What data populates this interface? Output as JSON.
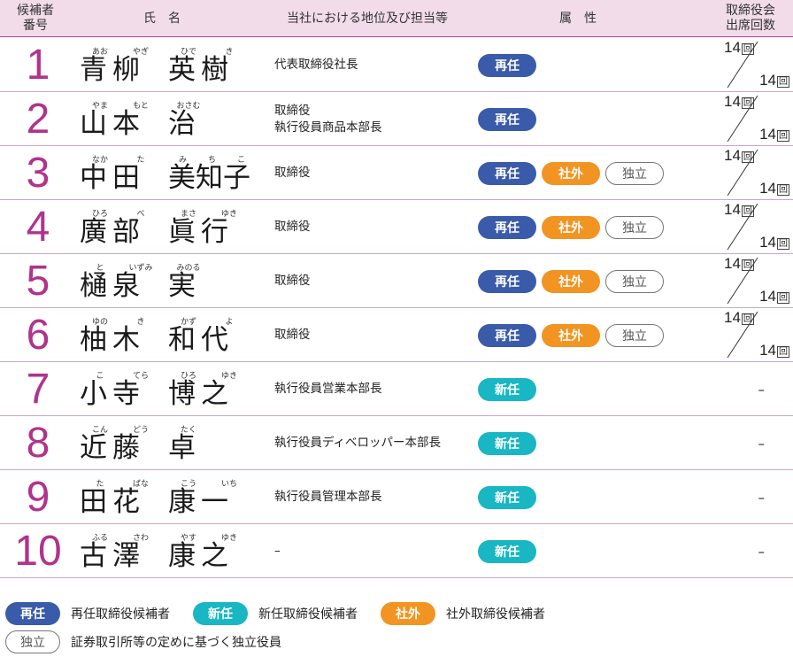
{
  "header": {
    "num_line1": "候補者",
    "num_line2": "番号",
    "name": "氏名",
    "position": "当社における地位及び担当等",
    "attributes": "属性",
    "attendance_line1": "取締役会",
    "attendance_line2": "出席回数"
  },
  "badges": {
    "reappoint": "再任",
    "new": "新任",
    "outside": "社外",
    "independent": "独立"
  },
  "attendance_unit": "回",
  "candidates": [
    {
      "num": "1",
      "surname": "青柳",
      "given": "英樹",
      "surname_ruby": [
        "あお",
        "やぎ"
      ],
      "given_ruby": [
        "ひで",
        "き"
      ],
      "position": [
        "代表取締役社長"
      ],
      "attendance_top": "14",
      "attendance_bottom": "14"
    },
    {
      "num": "2",
      "surname": "山本",
      "given": "治",
      "surname_ruby": [
        "やま",
        "もと"
      ],
      "given_ruby": [
        "おさむ"
      ],
      "position": [
        "取締役",
        "執行役員商品本部長"
      ],
      "attendance_top": "14",
      "attendance_bottom": "14"
    },
    {
      "num": "3",
      "surname": "中田",
      "given": "美知子",
      "surname_ruby": [
        "なか",
        "た"
      ],
      "given_ruby": [
        "み",
        "ち",
        "こ"
      ],
      "position": [
        "取締役"
      ],
      "attendance_top": "14",
      "attendance_bottom": "14"
    },
    {
      "num": "4",
      "surname": "廣部",
      "given": "眞行",
      "surname_ruby": [
        "ひろ",
        "べ"
      ],
      "given_ruby": [
        "まさ",
        "ゆき"
      ],
      "position": [
        "取締役"
      ],
      "attendance_top": "14",
      "attendance_bottom": "14"
    },
    {
      "num": "5",
      "surname": "樋泉",
      "given": "実",
      "surname_ruby": [
        "と",
        "いずみ"
      ],
      "given_ruby": [
        "みのる"
      ],
      "position": [
        "取締役"
      ],
      "attendance_top": "14",
      "attendance_bottom": "14"
    },
    {
      "num": "6",
      "surname": "柚木",
      "given": "和代",
      "surname_ruby": [
        "ゆの",
        "き"
      ],
      "given_ruby": [
        "かず",
        "よ"
      ],
      "position": [
        "取締役"
      ],
      "attendance_top": "14",
      "attendance_bottom": "14"
    },
    {
      "num": "7",
      "surname": "小寺",
      "given": "博之",
      "surname_ruby": [
        "こ",
        "てら"
      ],
      "given_ruby": [
        "ひろ",
        "ゆき"
      ],
      "position": [
        "執行役員営業本部長"
      ],
      "attendance_dash": "–"
    },
    {
      "num": "8",
      "surname": "近藤",
      "given": "卓",
      "surname_ruby": [
        "こん",
        "どう"
      ],
      "given_ruby": [
        "たく"
      ],
      "position": [
        "執行役員ディベロッパー本部長"
      ],
      "attendance_dash": "–"
    },
    {
      "num": "9",
      "surname": "田花",
      "given": "康一",
      "surname_ruby": [
        "た",
        "ばな"
      ],
      "given_ruby": [
        "こう",
        "いち"
      ],
      "position": [
        "執行役員管理本部長"
      ],
      "attendance_dash": "–"
    },
    {
      "num": "10",
      "surname": "古澤",
      "given": "康之",
      "surname_ruby": [
        "ふる",
        "さわ"
      ],
      "given_ruby": [
        "やす",
        "ゆき"
      ],
      "position": [
        "–"
      ],
      "attendance_dash": "–"
    }
  ],
  "legend": {
    "reappoint": "再任取締役候補者",
    "new": "新任取締役候補者",
    "outside": "社外取締役候補者",
    "independent": "証券取引所等の定めに基づく独立役員"
  }
}
